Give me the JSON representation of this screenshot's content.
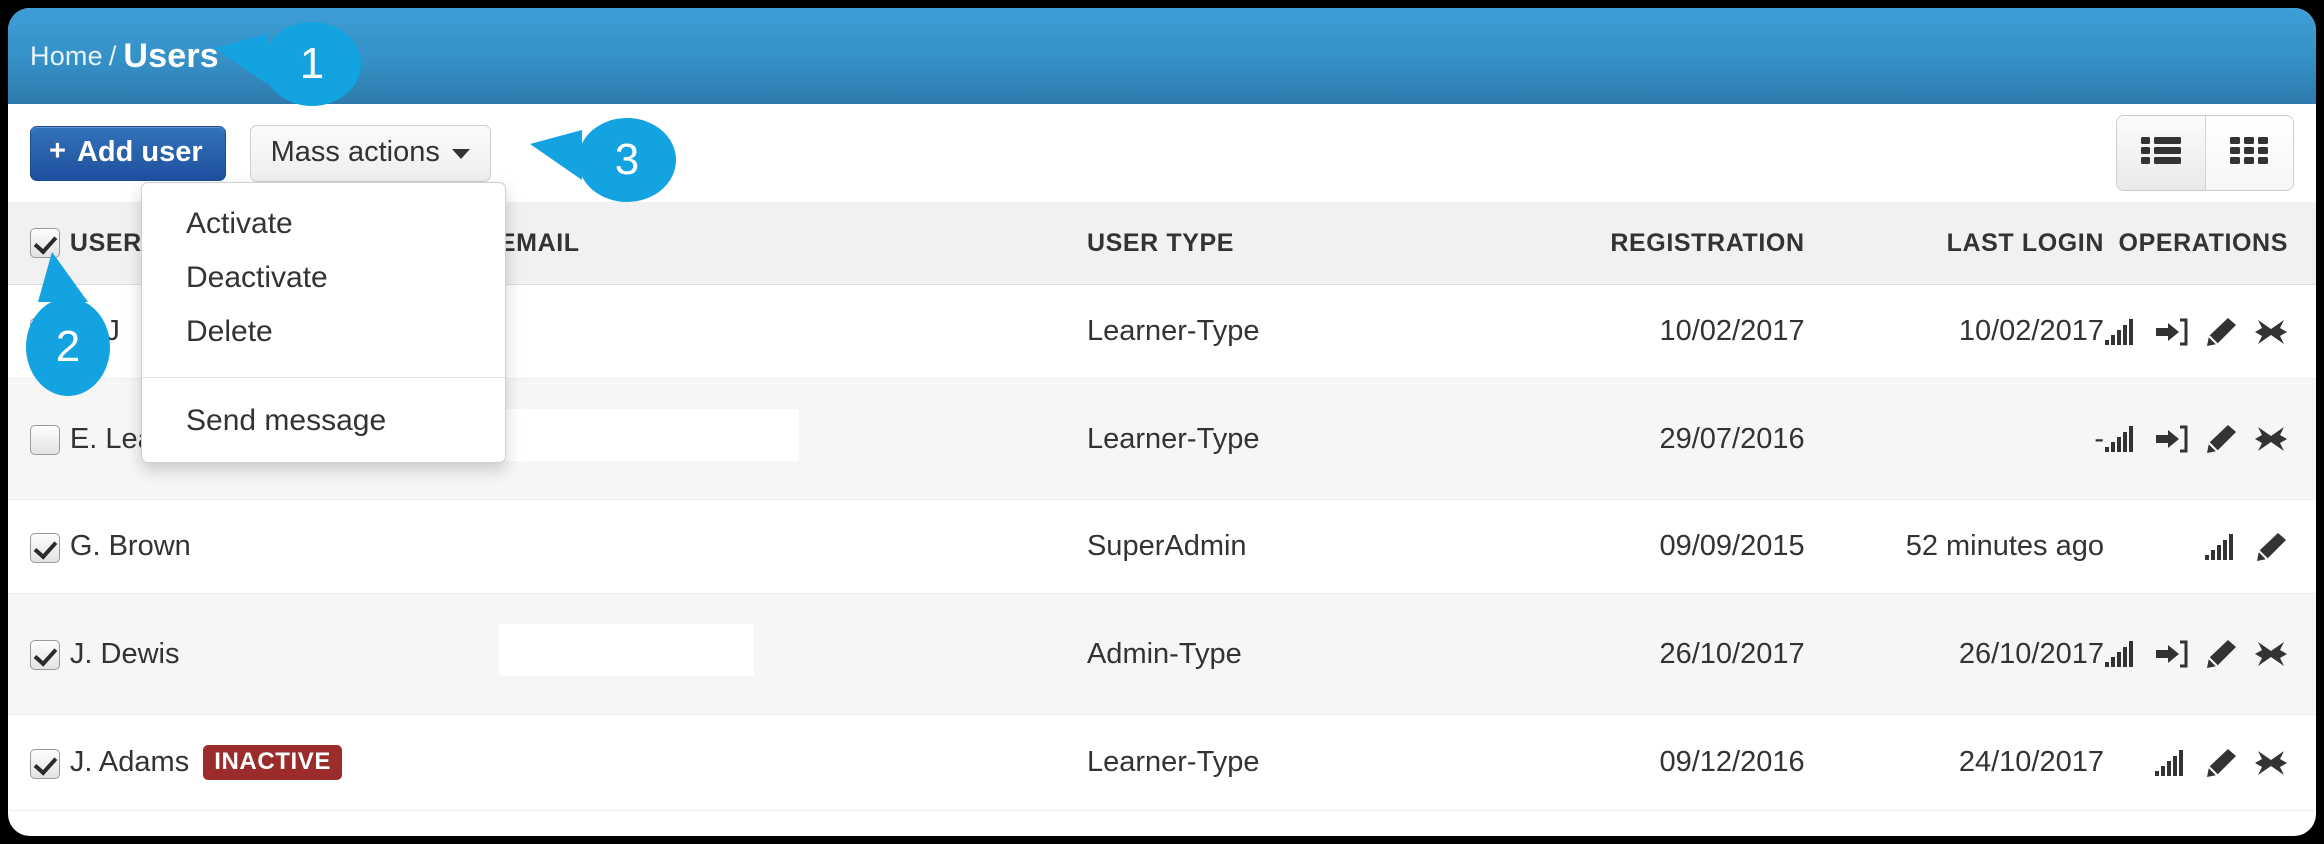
{
  "header": {
    "home_label": "Home",
    "separator": "/",
    "current_label": "Users"
  },
  "toolbar": {
    "add_user_label": "Add user",
    "add_user_plus": "+",
    "mass_actions_label": "Mass actions",
    "view_list_name": "list-view",
    "view_grid_name": "grid-view"
  },
  "dropdown": {
    "items": [
      {
        "label": "Activate"
      },
      {
        "label": "Deactivate"
      },
      {
        "label": "Delete"
      }
    ],
    "footer_item": {
      "label": "Send message"
    }
  },
  "table": {
    "columns": [
      {
        "key": "check",
        "label": ""
      },
      {
        "key": "name",
        "label": "USER"
      },
      {
        "key": "email",
        "label": "EMAIL"
      },
      {
        "key": "type",
        "label": "USER TYPE"
      },
      {
        "key": "registration",
        "label": "REGISTRATION"
      },
      {
        "key": "last_login",
        "label": "LAST LOGIN"
      },
      {
        "key": "operations",
        "label": "OPERATIONS"
      }
    ],
    "header_checkbox_checked": true,
    "rows": [
      {
        "checked": true,
        "name": "B. J",
        "badge": "",
        "email": "",
        "email_redacted": false,
        "type": "Learner-Type",
        "registration": "10/02/2017",
        "last_login": "10/02/2017",
        "operations": [
          "stats-icon",
          "login-as-icon",
          "edit-icon",
          "delete-icon"
        ]
      },
      {
        "checked": false,
        "name": "E. Leandros",
        "badge": "",
        "email": "",
        "email_redacted": true,
        "type": "Learner-Type",
        "registration": "29/07/2016",
        "last_login": "-",
        "operations": [
          "stats-icon",
          "login-as-icon",
          "edit-icon",
          "delete-icon"
        ]
      },
      {
        "checked": true,
        "name": "G. Brown",
        "badge": "",
        "email": "",
        "email_redacted": false,
        "type": "SuperAdmin",
        "registration": "09/09/2015",
        "last_login": "52 minutes ago",
        "operations": [
          "stats-icon",
          "edit-icon"
        ]
      },
      {
        "checked": true,
        "name": "J. Dewis",
        "badge": "",
        "email": "",
        "email_redacted": true,
        "type": "Admin-Type",
        "registration": "26/10/2017",
        "last_login": "26/10/2017",
        "operations": [
          "stats-icon",
          "login-as-icon",
          "edit-icon",
          "delete-icon"
        ]
      },
      {
        "checked": true,
        "name": "J. Adams",
        "badge": "INACTIVE",
        "email": "",
        "email_redacted": false,
        "type": "Learner-Type",
        "registration": "09/12/2016",
        "last_login": "24/10/2017",
        "operations": [
          "stats-icon",
          "edit-icon",
          "delete-icon"
        ]
      }
    ]
  },
  "callouts": [
    {
      "number": "1",
      "direction": "left"
    },
    {
      "number": "2",
      "direction": "up"
    },
    {
      "number": "3",
      "direction": "left"
    }
  ],
  "colors": {
    "header_blue_top": "#3d9fd6",
    "header_blue_bottom": "#2e7aad",
    "primary_button_blue": "#1d4fa0",
    "callout_blue": "#12a3e0",
    "badge_red": "#9c2b2b"
  }
}
